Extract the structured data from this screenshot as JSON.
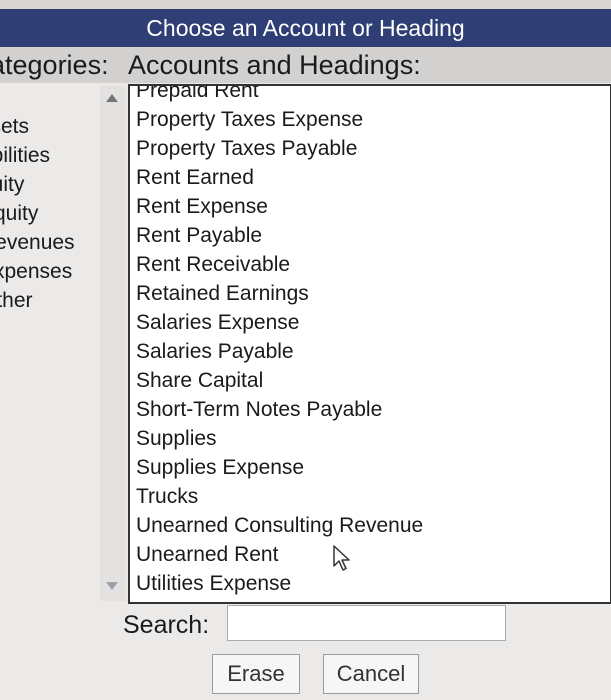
{
  "dialog": {
    "title": "Choose an Account or Heading"
  },
  "headers": {
    "categories": "ategories:",
    "accounts": "Accounts and Headings:"
  },
  "categories": [
    "ssets",
    "abilities",
    "quity",
    "Equity",
    "Revenues",
    "Expenses",
    "Other"
  ],
  "accounts": [
    "Prepaid Rent",
    "Property Taxes Expense",
    "Property Taxes Payable",
    "Rent Earned",
    "Rent Expense",
    "Rent Payable",
    "Rent Receivable",
    "Retained Earnings",
    "Salaries Expense",
    "Salaries Payable",
    "Share Capital",
    "Short-Term Notes Payable",
    "Supplies",
    "Supplies Expense",
    "Trucks",
    "Unearned Consulting Revenue",
    "Unearned Rent",
    "Utilities Expense"
  ],
  "search": {
    "label": "Search:",
    "value": ""
  },
  "buttons": {
    "erase": "Erase",
    "cancel": "Cancel"
  },
  "colors": {
    "title_bar": "#2f3e74",
    "header_bar": "#d3d1d0"
  }
}
